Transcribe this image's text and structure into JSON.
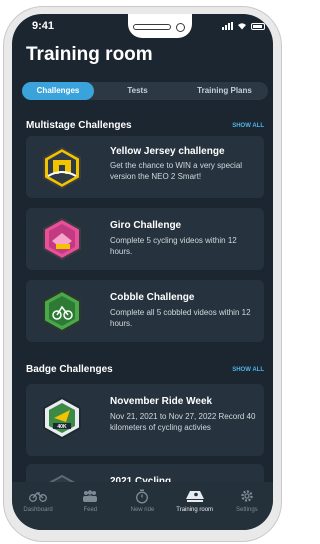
{
  "status": {
    "time": "9:41"
  },
  "page": {
    "title": "Training room"
  },
  "tabs": [
    {
      "label": "Challenges",
      "active": true
    },
    {
      "label": "Tests",
      "active": false
    },
    {
      "label": "Training Plans",
      "active": false
    }
  ],
  "multistage": {
    "title": "Multistage Challenges",
    "show_all": "SHOW ALL",
    "cards": [
      {
        "title": "Yellow Jersey challenge",
        "desc": "Get the chance to WIN a very special version the NEO 2 Smart!",
        "icon": "arc-de-triomphe-badge-icon"
      },
      {
        "title": "Giro Challenge",
        "desc": "Complete 5 cycling videos within 12 hours.",
        "icon": "giro-pink-badge-icon"
      },
      {
        "title": "Cobble Challenge",
        "desc": "Complete all 5 cobbled videos within 12 hours.",
        "icon": "cobble-green-badge-icon"
      }
    ]
  },
  "badges": {
    "title": "Badge Challenges",
    "show_all": "SHOW ALL",
    "cards": [
      {
        "title": "November Ride Week",
        "desc": "Nov 21, 2021 to Nov 27, 2022 Record 40 kilometers of cycling activies",
        "icon": "40k-ride-badge-icon",
        "badge_text": "40K"
      },
      {
        "title": "2021 Cycling",
        "desc": "",
        "icon": "cycling-badge-icon"
      }
    ]
  },
  "nav": [
    {
      "label": "Dashboard",
      "icon": "bike-icon",
      "active": false
    },
    {
      "label": "Feed",
      "icon": "people-icon",
      "active": false
    },
    {
      "label": "New ride",
      "icon": "stopwatch-icon",
      "active": false
    },
    {
      "label": "Training room",
      "icon": "training-room-icon",
      "active": true
    },
    {
      "label": "Settings",
      "icon": "gear-icon",
      "active": false
    }
  ],
  "colors": {
    "accent": "#3ba3dc",
    "background": "#1c2630",
    "card": "#26323d"
  }
}
